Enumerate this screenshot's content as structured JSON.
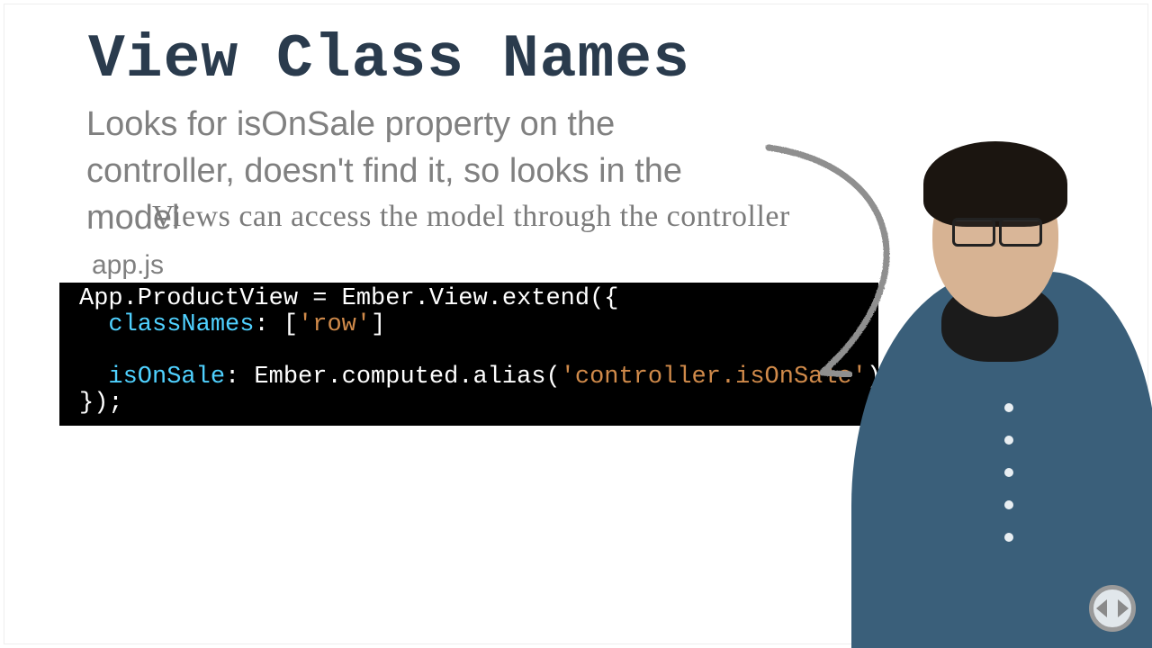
{
  "title": "View Class Names",
  "subtitle": "Looks for isOnSale property on the controller, doesn't find it, so looks in the model",
  "hand_note": "Views can access the model through the controller",
  "filename": "app.js",
  "code": {
    "l1a": "App.ProductView = Ember.View.extend({",
    "l2a": "  ",
    "l2b": "classNames",
    "l2c": ": [",
    "l2d": "'row'",
    "l2e": "]",
    "l3": "",
    "l4a": "  ",
    "l4b": "isOnSale",
    "l4c": ": Ember.computed.alias(",
    "l4d": "'controller.isOnSale'",
    "l4e": ")",
    "l5": "});"
  },
  "arrow_desc": "arrow-to-code",
  "nav": {
    "left": "prev",
    "right": "next"
  }
}
